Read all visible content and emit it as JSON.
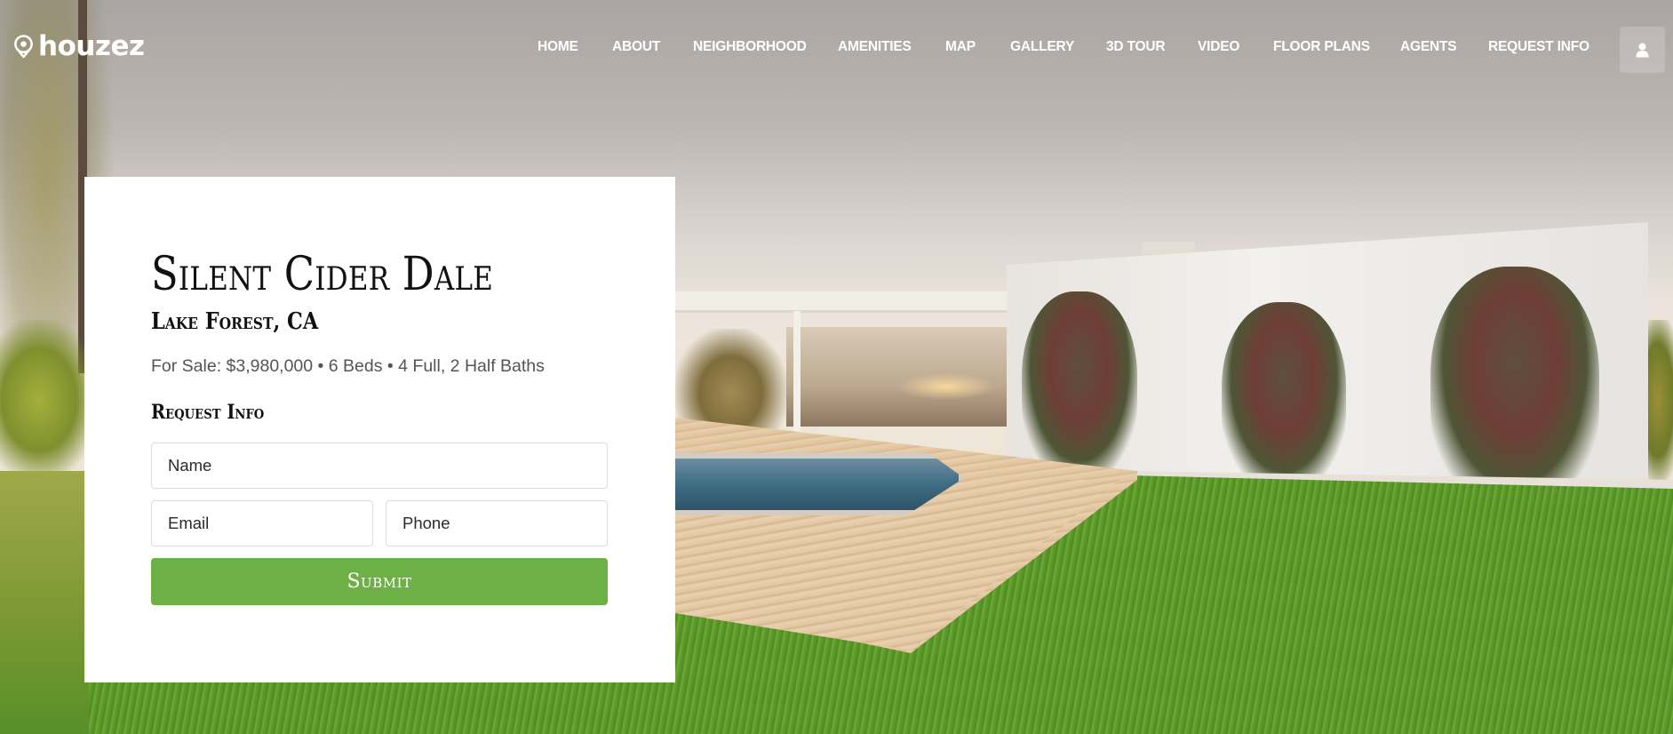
{
  "brand": {
    "name": "houzez",
    "logo_icon": "map-pin-icon"
  },
  "nav": {
    "items": [
      {
        "label": "HOME"
      },
      {
        "label": "ABOUT"
      },
      {
        "label": "NEIGHBORHOOD"
      },
      {
        "label": "AMENITIES"
      },
      {
        "label": "MAP"
      },
      {
        "label": "GALLERY"
      },
      {
        "label": "3D TOUR"
      },
      {
        "label": "VIDEO"
      },
      {
        "label": "FLOOR PLANS"
      },
      {
        "label": "AGENTS"
      },
      {
        "label": "REQUEST INFO"
      }
    ],
    "user_icon": "user-icon"
  },
  "listing": {
    "title": "Silent Cider Dale",
    "location": "Lake Forest, CA",
    "details": "For Sale: $3,980,000 • 6 Beds • 4 Full, 2 Half Baths",
    "status": "For Sale",
    "price": "$3,980,000",
    "beds": "6 Beds",
    "baths": "4 Full, 2 Half Baths"
  },
  "form": {
    "heading": "Request Info",
    "name_placeholder": "Name",
    "name_value": "",
    "email_placeholder": "Email",
    "email_value": "",
    "phone_placeholder": "Phone",
    "phone_value": "",
    "submit_label": "Submit"
  },
  "colors": {
    "accent": "#6db046",
    "card_bg": "#ffffff",
    "nav_text": "#ffffff",
    "heading_text": "#111111",
    "meta_text": "#555555"
  },
  "hero": {
    "image_description": "modern white house with pergola, pool, wooden deck and green lawn at sunset"
  }
}
